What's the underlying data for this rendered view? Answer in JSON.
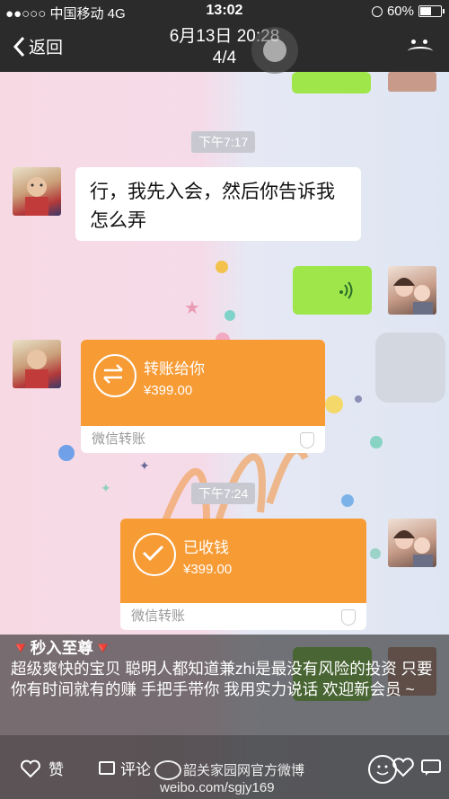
{
  "status_bar": {
    "carrier": "●●○○○ 中国移动",
    "network": "4G",
    "time": "13:02",
    "battery": "60%",
    "battery_level": 0.6
  },
  "nav": {
    "back_label": "返回",
    "date": "6月13日 20:28",
    "page": "4/4"
  },
  "chat": {
    "time1": "下午7:17",
    "msg_text": "行，我先入会，然后你告诉我怎么弄",
    "transfer_sent": {
      "title": "转账给你",
      "amount": "¥399.00",
      "footer": "微信转账"
    },
    "time2": "下午7:24",
    "transfer_received": {
      "title": "已收钱",
      "amount": "¥399.00",
      "footer": "微信转账"
    }
  },
  "caption": {
    "heading": "🔻秒入至尊🔻",
    "body": "超级爽快的宝贝 聪明人都知道兼zhi是最没有风险的投资 只要你有时间就有的赚 手把手带你 我用实力说话 欢迎新会员 ~"
  },
  "bottom": {
    "like_label": "赞",
    "comment_label": "评论",
    "watermark_line1": "韶关家园网官方微博",
    "watermark_line2": "weibo.com/sgjy169"
  },
  "colors": {
    "transfer_orange": "#f79b35",
    "voice_green": "#9ee64a",
    "nav_bg": "#2b2b2b"
  }
}
